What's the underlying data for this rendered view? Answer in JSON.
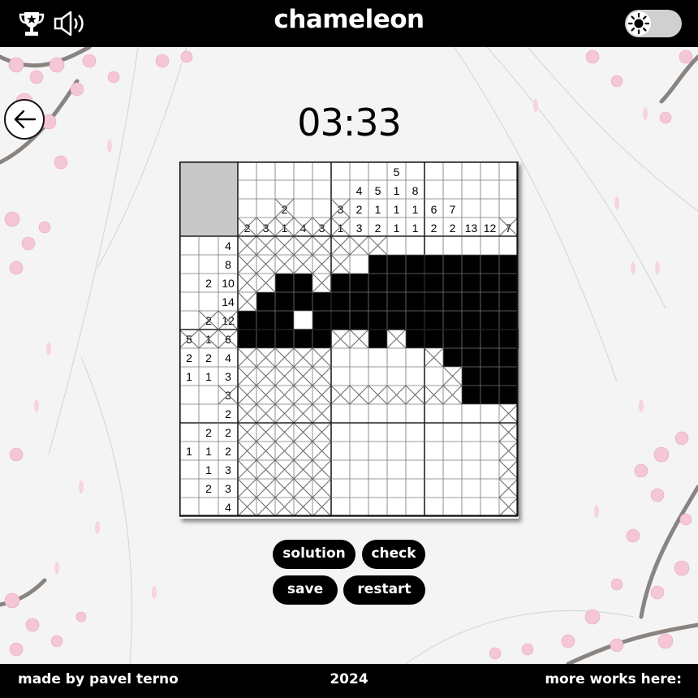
{
  "header": {
    "title": "chameleon",
    "icons": {
      "trophy": "trophy-icon",
      "sound": "speaker-icon",
      "theme": "sun-icon"
    }
  },
  "timer": "03:33",
  "puzzle": {
    "rows": 15,
    "cols": 15,
    "column_clues": [
      [
        "2"
      ],
      [
        "3"
      ],
      [
        "2",
        "1"
      ],
      [
        "4"
      ],
      [
        "3"
      ],
      [
        "3",
        "1"
      ],
      [
        "4",
        "2",
        "3"
      ],
      [
        "5",
        "1",
        "2"
      ],
      [
        "5",
        "1",
        "1",
        "1"
      ],
      [
        "8",
        "1",
        "1"
      ],
      [
        "6",
        "2"
      ],
      [
        "7",
        "2"
      ],
      [
        "13"
      ],
      [
        "12"
      ],
      [
        "7"
      ]
    ],
    "row_clues": [
      [
        "4"
      ],
      [
        "8"
      ],
      [
        "2",
        "10"
      ],
      [
        "14"
      ],
      [
        "2",
        "12"
      ],
      [
        "5",
        "1",
        "6"
      ],
      [
        "2",
        "2",
        "4"
      ],
      [
        "1",
        "1",
        "3"
      ],
      [
        "3"
      ],
      [
        "2"
      ],
      [
        "2",
        "2"
      ],
      [
        "1",
        "1",
        "2"
      ],
      [
        "1",
        "3"
      ],
      [
        "2",
        "3"
      ],
      [
        "4"
      ]
    ],
    "crossed_column_clues": [
      [
        "2"
      ],
      [
        "3"
      ],
      [
        "2",
        "1"
      ],
      [
        "4"
      ],
      [
        "3"
      ],
      [
        "3",
        "1"
      ],
      [],
      [],
      [],
      [],
      [],
      [],
      [],
      [],
      [
        "7"
      ]
    ],
    "crossed_row_clues": [
      [],
      [],
      [],
      [],
      [
        "2",
        "12"
      ],
      [
        "5",
        "1",
        "6"
      ],
      [],
      [],
      [
        "3"
      ],
      [],
      [],
      [],
      [],
      [],
      []
    ],
    "grid": [
      "XXXXXXXX.......",
      "XXXXXX.########",
      "XX##X##########",
      "X##############",
      "###.###########",
      "#####XX#X#######",
      "XXXXX.....X####",
      "XXXXX......X###",
      "XXXXXXXXXXXX###",
      "XXXXX.........X",
      "XXXXX.........X",
      "XXXXX.........X",
      "XXXXX.........X",
      "XXXXX.........X",
      "XXXXX.........X"
    ]
  },
  "buttons": {
    "solution": "solution",
    "check": "check",
    "save": "save",
    "restart": "restart"
  },
  "footer": {
    "left": "made by pavel terno",
    "center": "2024",
    "right": "more works here:"
  },
  "colors": {
    "bar": "#000000",
    "background": "#f4f4f4",
    "filled": "#000000",
    "gridline": "#666666",
    "blossom": "#f4c6d6"
  }
}
